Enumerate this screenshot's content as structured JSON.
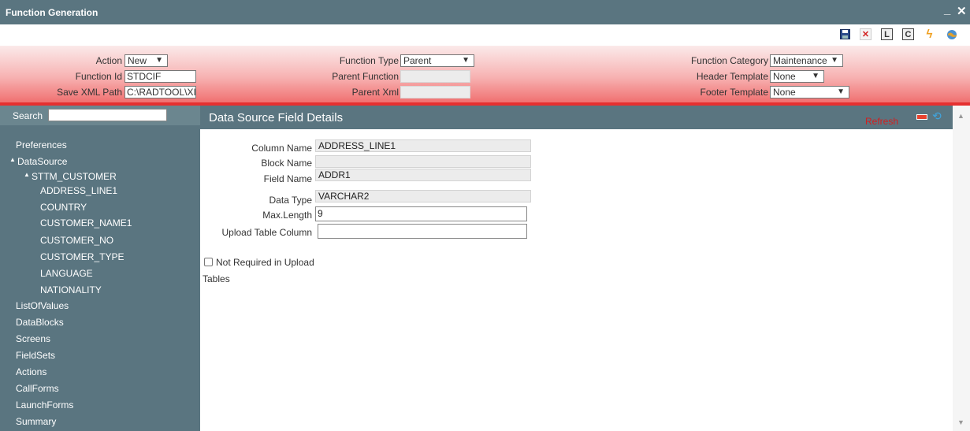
{
  "window": {
    "title": "Function Generation",
    "minimize": "_",
    "close": "✕"
  },
  "toolbar": {
    "icons": [
      "save-icon",
      "delete-icon",
      "l-icon",
      "c-icon",
      "lightning-icon",
      "globe-icon"
    ],
    "l_label": "L",
    "c_label": "C",
    "delete_glyph": "✕",
    "lightning_glyph": "ϟ"
  },
  "header": {
    "action_label": "Action",
    "action_value": "New",
    "function_id_label": "Function Id",
    "function_id_value": "STDCIF",
    "save_xml_label": "Save XML Path",
    "save_xml_value": "C:\\RADTOOL\\XI",
    "function_type_label": "Function Type",
    "function_type_value": "Parent",
    "parent_function_label": "Parent Function",
    "parent_xml_label": "Parent Xml",
    "function_category_label": "Function Category",
    "function_category_value": "Maintenance",
    "header_template_label": "Header Template",
    "header_template_value": "None",
    "footer_template_label": "Footer Template",
    "footer_template_value": "None"
  },
  "sidebar": {
    "search_label": "Search",
    "items": {
      "preferences": "Preferences",
      "datasource": "DataSource",
      "sttm_customer": "STTM_CUSTOMER",
      "fields": [
        "ADDRESS_LINE1",
        "COUNTRY",
        "CUSTOMER_NAME1",
        "CUSTOMER_NO",
        "CUSTOMER_TYPE",
        "LANGUAGE",
        "NATIONALITY"
      ],
      "listofvalues": "ListOfValues",
      "datablocks": "DataBlocks",
      "screens": "Screens",
      "fieldsets": "FieldSets",
      "actions": "Actions",
      "callforms": "CallForms",
      "launchforms": "LaunchForms",
      "summary": "Summary"
    }
  },
  "panel": {
    "title": "Data Source Field Details",
    "refresh": "Refresh",
    "column_name_label": "Column Name",
    "column_name_value": "ADDRESS_LINE1",
    "block_name_label": "Block Name",
    "block_name_value": "",
    "field_name_label": "Field Name",
    "field_name_value": "ADDR1",
    "data_type_label": "Data Type",
    "data_type_value": "VARCHAR2",
    "max_length_label": "Max.Length",
    "max_length_value": "9",
    "upload_table_column_label": "Upload Table Column",
    "upload_table_column_value": "",
    "not_required_label_1": "Not Required in Upload",
    "not_required_label_2": "Tables"
  },
  "colors": {
    "frame": "#5a7580",
    "header_red": "#e53030",
    "refresh": "#d21f1f"
  }
}
